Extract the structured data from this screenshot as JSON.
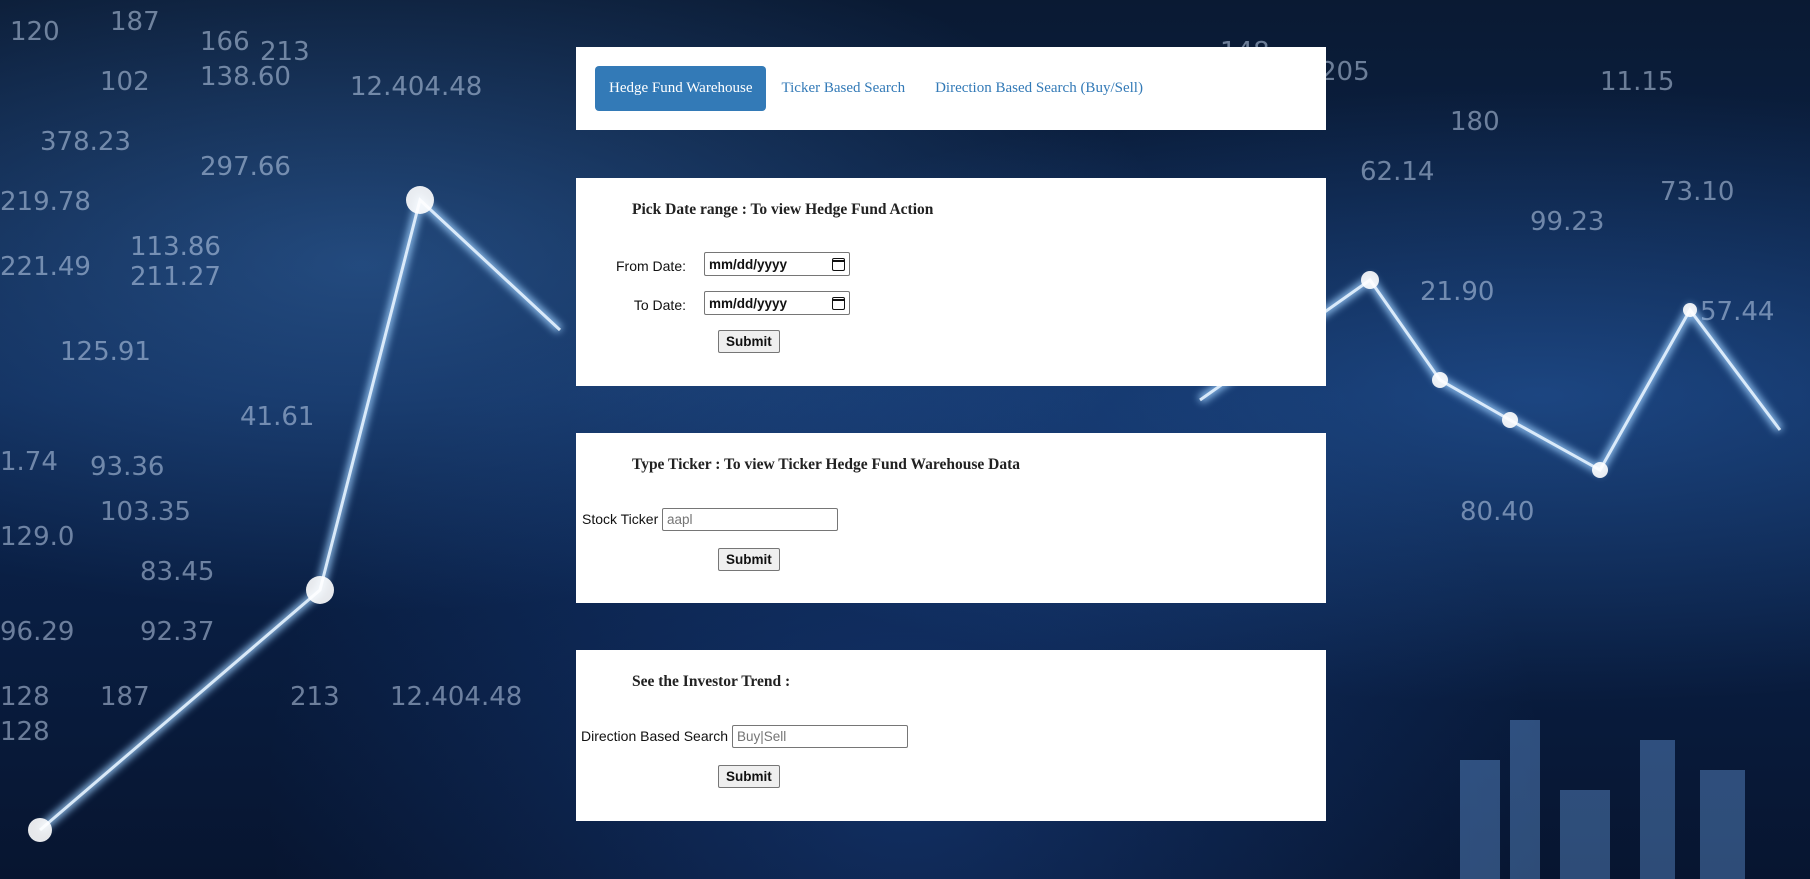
{
  "nav": {
    "items": [
      {
        "label": "Hedge Fund Warehouse",
        "active": true
      },
      {
        "label": "Ticker Based Search",
        "active": false
      },
      {
        "label": "Direction Based Search (Buy/Sell)",
        "active": false
      }
    ]
  },
  "date_range": {
    "heading": "Pick Date range : To view Hedge Fund Action",
    "from_label": "From Date:",
    "from_value": "mm/dd/yyyy",
    "to_label": "To Date:",
    "to_value": "mm/dd/yyyy",
    "submit_label": "Submit"
  },
  "ticker": {
    "heading": "Type Ticker : To view Ticker Hedge Fund Warehouse Data",
    "label": "Stock Ticker",
    "placeholder": "aapl",
    "submit_label": "Submit"
  },
  "trend": {
    "heading": "See the Investor Trend :",
    "label": "Direction Based Search",
    "placeholder": "Buy|Sell",
    "submit_label": "Submit"
  },
  "colors": {
    "accent": "#337ab7",
    "panel": "#ffffff",
    "background": "#0b2550"
  }
}
